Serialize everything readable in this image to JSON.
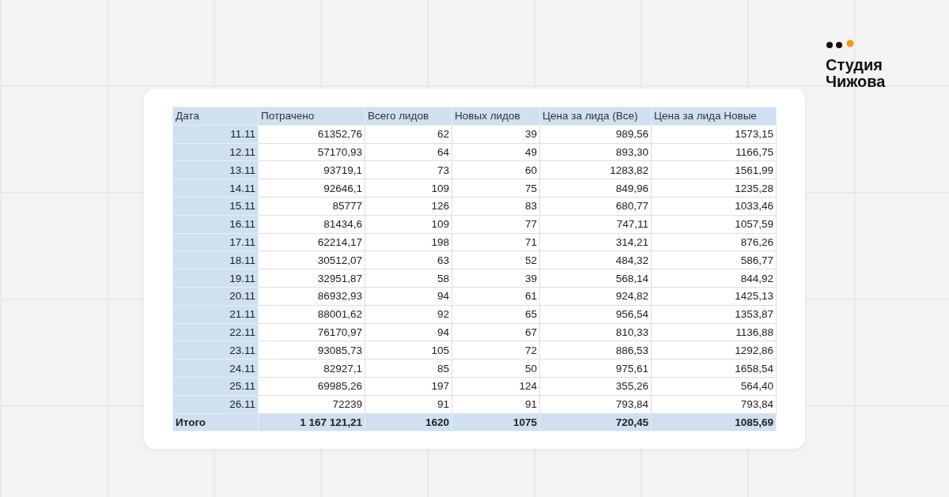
{
  "logo": {
    "line_1": "Студия",
    "line_2": "Чижова"
  },
  "table": {
    "columns": [
      "Дата",
      "Потрачено",
      "Всего лидов",
      "Новых лидов",
      "Цена за лида (Все)",
      "Цена за лида Новые"
    ],
    "rows": [
      [
        "11.11",
        "61352,76",
        "62",
        "39",
        "989,56",
        "1573,15"
      ],
      [
        "12.11",
        "57170,93",
        "64",
        "49",
        "893,30",
        "1166,75"
      ],
      [
        "13.11",
        "93719,1",
        "73",
        "60",
        "1283,82",
        "1561,99"
      ],
      [
        "14.11",
        "92646,1",
        "109",
        "75",
        "849,96",
        "1235,28"
      ],
      [
        "15.11",
        "85777",
        "126",
        "83",
        "680,77",
        "1033,46"
      ],
      [
        "16.11",
        "81434,6",
        "109",
        "77",
        "747,11",
        "1057,59"
      ],
      [
        "17.11",
        "62214,17",
        "198",
        "71",
        "314,21",
        "876,26"
      ],
      [
        "18.11",
        "30512,07",
        "63",
        "52",
        "484,32",
        "586,77"
      ],
      [
        "19.11",
        "32951,87",
        "58",
        "39",
        "568,14",
        "844,92"
      ],
      [
        "20.11",
        "86932,93",
        "94",
        "61",
        "924,82",
        "1425,13"
      ],
      [
        "21.11",
        "88001,62",
        "92",
        "65",
        "956,54",
        "1353,87"
      ],
      [
        "22.11",
        "76170,97",
        "94",
        "67",
        "810,33",
        "1136,88"
      ],
      [
        "23.11",
        "93085,73",
        "105",
        "72",
        "886,53",
        "1292,86"
      ],
      [
        "24.11",
        "82927,1",
        "85",
        "50",
        "975,61",
        "1658,54"
      ],
      [
        "25.11",
        "69985,26",
        "197",
        "124",
        "355,26",
        "564,40"
      ],
      [
        "26.11",
        "72239",
        "91",
        "91",
        "793,84",
        "793,84"
      ]
    ],
    "total": [
      "Итого",
      "1 167 121,21",
      "1620",
      "1075",
      "720,45",
      "1085,69"
    ]
  }
}
